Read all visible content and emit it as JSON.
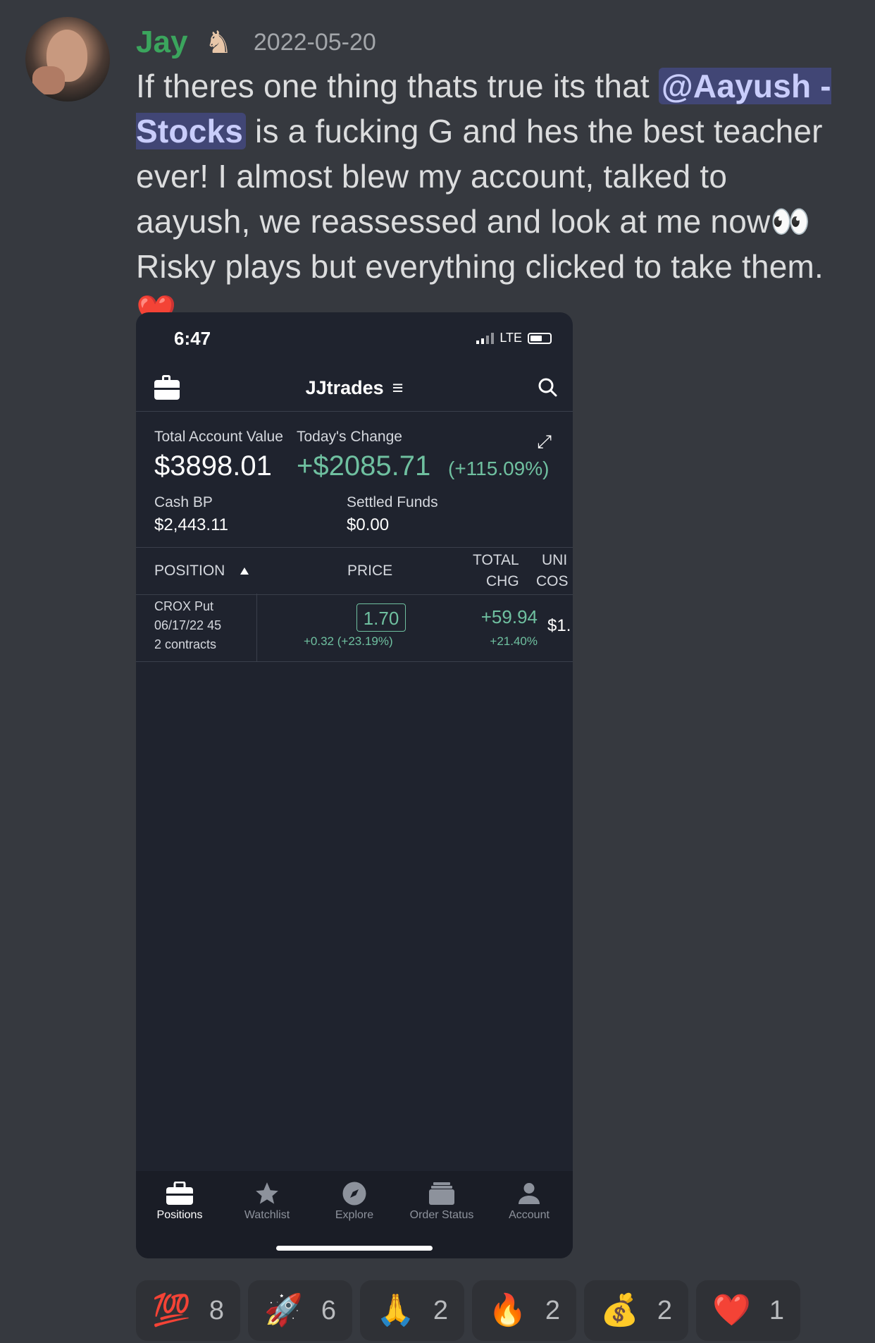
{
  "message": {
    "author": "Jay",
    "author_badge_icon": "chess-knight-icon",
    "timestamp": "2022-05-20",
    "text_before_mention": "If theres one thing thats true its that ",
    "mention": "@Aayush - Stocks",
    "text_after_mention": " is a fucking G and hes the best teacher ever! I almost blew my account, talked to aayush, we reassessed and look at me now",
    "eyes_emoji": "👀",
    "text_end": " Risky plays but everything clicked to take them. ",
    "heart_emoji": "❤️"
  },
  "screenshot": {
    "status_time": "6:47",
    "network": "LTE",
    "nav_title": "JJtrades",
    "menu_glyph": "≡",
    "summary": {
      "total_label": "Total Account Value",
      "change_label": "Today's Change",
      "total_value": "$3898.01",
      "change_value": "+$2085.71",
      "change_pct": "(+115.09%)",
      "cash_bp_label": "Cash BP",
      "cash_bp_value": "$2,443.11",
      "settled_label": "Settled Funds",
      "settled_value": "$0.00"
    },
    "table": {
      "col_position": "POSITION",
      "col_price": "PRICE",
      "col_total_1": "TOTAL",
      "col_total_2": "CHG",
      "col_unit_1": "UNI",
      "col_unit_2": "COS",
      "row": {
        "line1": "CROX Put",
        "line2": "06/17/22 45",
        "line3": "2 contracts",
        "price": "1.70",
        "price_change": "+0.32 (+23.19%)",
        "total_change": "+59.94",
        "total_pct": "+21.40%",
        "unit_cost": "$1."
      }
    },
    "tabs": [
      "Positions",
      "Watchlist",
      "Explore",
      "Order Status",
      "Account"
    ],
    "accent_color": "#6fc0a0"
  },
  "reactions": [
    {
      "emoji": "💯",
      "count": "8"
    },
    {
      "emoji": "🚀",
      "count": "6"
    },
    {
      "emoji": "🙏",
      "count": "2"
    },
    {
      "emoji": "🔥",
      "count": "2"
    },
    {
      "emoji": "💰",
      "count": "2"
    },
    {
      "emoji": "❤️",
      "count": "1"
    }
  ]
}
